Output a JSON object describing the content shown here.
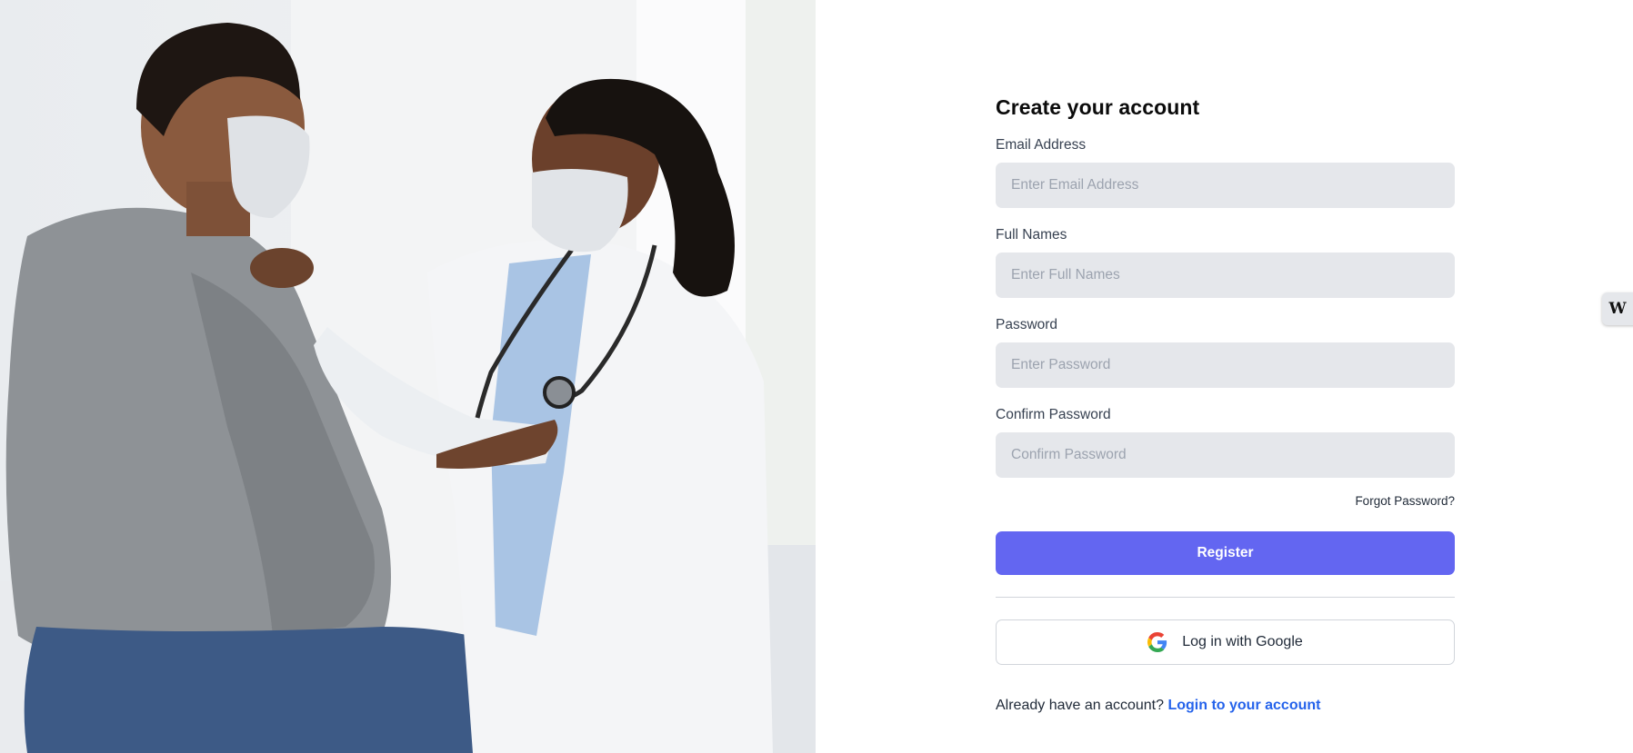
{
  "form": {
    "title": "Create your account",
    "fields": [
      {
        "label": "Email Address",
        "placeholder": "Enter Email Address",
        "value": ""
      },
      {
        "label": "Full Names",
        "placeholder": "Enter Full Names",
        "value": ""
      },
      {
        "label": "Password",
        "placeholder": "Enter Password",
        "value": ""
      },
      {
        "label": "Confirm Password",
        "placeholder": "Confirm Password",
        "value": ""
      }
    ],
    "forgot_password": "Forgot Password?",
    "register_label": "Register",
    "google_label": "Log in with Google",
    "google_icon": "google-icon",
    "footer_text": "Already have an account?",
    "footer_link": "Login to your account"
  },
  "side_widget": {
    "label": "W",
    "icon": "w-logo-icon"
  },
  "colors": {
    "primary": "#6366f1",
    "link": "#2563eb",
    "input_bg": "#e5e7eb"
  }
}
